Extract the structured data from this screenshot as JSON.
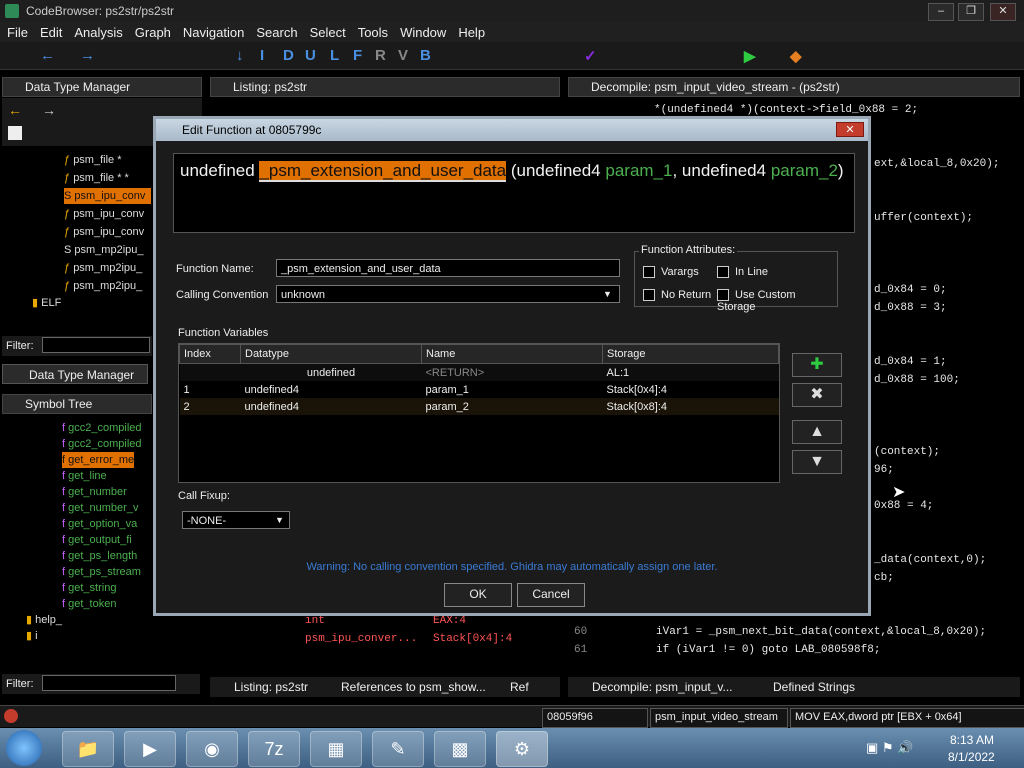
{
  "window": {
    "title": "CodeBrowser: ps2str/ps2str"
  },
  "menu": [
    "File",
    "Edit",
    "Analysis",
    "Graph",
    "Navigation",
    "Search",
    "Select",
    "Tools",
    "Window",
    "Help"
  ],
  "toolbar_letters": [
    "I",
    "D",
    "U",
    "L",
    "F",
    "R",
    "V",
    "B"
  ],
  "data_type_manager": {
    "title": "Data Type Manager",
    "items": [
      "psm_file *",
      "psm_file * *",
      "psm_ipu_conv",
      "psm_ipu_conv",
      "psm_ipu_conv",
      "psm_mp2ipu_",
      "psm_mp2ipu_",
      "psm_mp2ipu_",
      "ELF"
    ],
    "filter_label": "Filter:",
    "tab": "Data Type Manager"
  },
  "symbol_tree": {
    "title": "Symbol Tree",
    "items": [
      "gcc2_compiled",
      "gcc2_compiled",
      "get_error_me",
      "get_line",
      "get_number",
      "get_number_v",
      "get_option_va",
      "get_output_fi",
      "get_ps_length",
      "get_ps_stream",
      "get_string",
      "get_token",
      "help_",
      "i"
    ],
    "filter_label": "Filter:"
  },
  "listing": {
    "title": "Listing:  ps2str",
    "rows": [
      {
        "type": "int",
        "storage": "EAX:4"
      },
      {
        "type": "psm_ipu_conver...",
        "storage": "Stack[0x4]:4"
      }
    ],
    "tabs": [
      "Listing:  ps2str",
      "References to psm_show...",
      "Ref"
    ]
  },
  "decompile": {
    "title": "Decompile: psm_input_video_stream -  (ps2str)",
    "lines": [
      "*(undefined4 *)(context->field_0x88 = 2;",
      "ext,&local_8,0x20);",
      "uffer(context);",
      "d_0x84 = 0;",
      "d_0x88 = 3;",
      "d_0x84 = 1;",
      "d_0x88 = 100;",
      "(context);",
      "96;",
      "0x88 = 4;",
      "_data(context,0);",
      "cb;"
    ],
    "numbered": [
      {
        "num": "60",
        "text": "iVar1 = _psm_next_bit_data(context,&local_8,0x20);"
      },
      {
        "num": "61",
        "text": "if (iVar1 != 0) goto LAB_080598f8;"
      }
    ],
    "tabs": [
      "Decompile: psm_input_v...",
      "Defined Strings"
    ]
  },
  "dialog": {
    "title": "Edit Function at 0805799c",
    "signature": {
      "return_type": "undefined",
      "name": "_psm_extension_and_user_data",
      "open": "(undefined4 ",
      "param1": "param_1",
      "sep": ", undefined4",
      "param2": "param_2",
      "close": ")"
    },
    "function_name_label": "Function Name:",
    "function_name_value": "_psm_extension_and_user_data",
    "calling_convention_label": "Calling Convention",
    "calling_convention_value": "unknown",
    "attributes_label": "Function Attributes:",
    "attributes": {
      "varargs": "Varargs",
      "inline": "In Line",
      "no_return": "No Return",
      "custom_storage": "Use Custom Storage"
    },
    "variables_label": "Function Variables",
    "columns": [
      "Index",
      "Datatype",
      "Name",
      "Storage"
    ],
    "rows": [
      {
        "index": "",
        "datatype": "undefined",
        "name": "<RETURN>",
        "storage": "AL:1"
      },
      {
        "index": "1",
        "datatype": "undefined4",
        "name": "param_1",
        "storage": "Stack[0x4]:4"
      },
      {
        "index": "2",
        "datatype": "undefined4",
        "name": "param_2",
        "storage": "Stack[0x8]:4"
      }
    ],
    "call_fixup_label": "Call Fixup:",
    "call_fixup_value": "-NONE-",
    "warning": "Warning: No calling convention specified. Ghidra may automatically assign one later.",
    "ok": "OK",
    "cancel": "Cancel"
  },
  "status": {
    "address": "08059f96",
    "function": "psm_input_video_stream",
    "instruction": "MOV EAX,dword ptr [EBX + 0x64]"
  },
  "clock": {
    "time": "8:13 AM",
    "date": "8/1/2022"
  },
  "colors": {
    "accent": "#e07000",
    "green": "#4caf50",
    "warning": "#3a7bd5"
  }
}
